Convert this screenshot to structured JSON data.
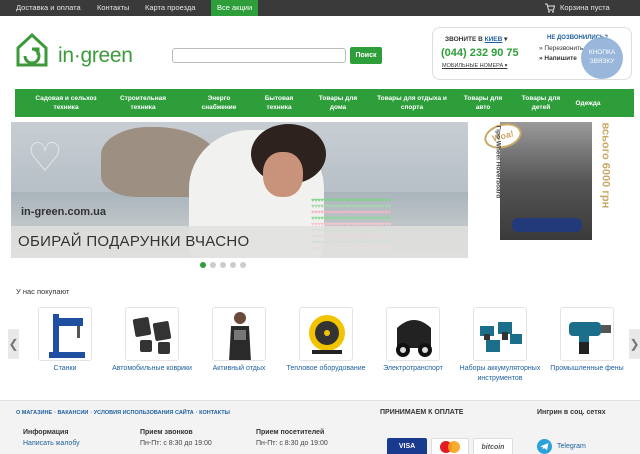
{
  "topbar": {
    "links": [
      "Доставка и оплата",
      "Контакты",
      "Карта проезда"
    ],
    "active_link": "Все акции",
    "cart": "Корзина пуста"
  },
  "header": {
    "logo_text": "in·green",
    "search_placeholder": "",
    "search_button": "Поиск",
    "call_label": "ЗВОНИТЕ В",
    "city": "КИЕВ",
    "phone": "(044) 232 90 75",
    "mobile": "МОБИЛЬНЫЕ НОМЕРА",
    "no_call_q": "НЕ ДОЗВОНИЛИСЬ?",
    "callback_line1": "Перезвонить",
    "callback_line2": "Напишите",
    "callback_button": "КНОПКА ЗВЯЗКУ"
  },
  "nav": [
    "Садовая и сельхоз техника",
    "Строительная техника",
    "Энерго снабжение",
    "Бытовая техника",
    "Товары для дома",
    "Товары для отдыха и спорта",
    "Товары для авто",
    "Товары для детей",
    "Одежда"
  ],
  "banner": {
    "site": "in-green.com.ua",
    "title": "ОБИРАЙ ПОДАРУНКИ ВЧАСНО",
    "slides": 5,
    "active_slide": 1
  },
  "side_banner": {
    "badge": "Woa!",
    "vertical_text": "Гіро Wheel Hoverboard",
    "price": "всього 6000 грн"
  },
  "products": {
    "title": "У нас покупают",
    "items": [
      {
        "label": "Станки",
        "icon": "drill-machine-icon"
      },
      {
        "label": "Автомобильные коврики",
        "icon": "car-mats-icon"
      },
      {
        "label": "Активный отдых",
        "icon": "wetsuit-icon"
      },
      {
        "label": "Тепловое оборудование",
        "icon": "heater-icon"
      },
      {
        "label": "Электротранспорт",
        "icon": "scooter-icon"
      },
      {
        "label": "Наборы аккумуляторных инструментов",
        "icon": "tool-set-icon"
      },
      {
        "label": "Промышленные фены",
        "icon": "heat-gun-icon"
      }
    ]
  },
  "footer": {
    "links": [
      "О МАГАЗИНЕ",
      "ВАКАНСИИ",
      "УСЛОВИЯ ИСПОЛЬЗОВАНИЯ САЙТА",
      "КОНТАКТЫ"
    ],
    "payments_title": "ПРИНИМАЕМ К ОПЛАТЕ",
    "social_title": "Ингрин в соц. сетях",
    "info_title": "Информация",
    "info_link": "Написать жалобу",
    "calls_title": "Прием звонков",
    "calls_hours": "Пн-Пт: с 8:30 до 19:00",
    "visitors_title": "Прием посетителей",
    "visitors_hours": "Пн-Пт: с 8:30 до 19:00",
    "payments": [
      "VISA",
      "MasterCard",
      "bitcoin"
    ],
    "telegram": "Telegram"
  },
  "colors": {
    "brand_green": "#2d9e3a",
    "topbar": "#3a3a3a",
    "link_blue": "#1d5f9e"
  }
}
